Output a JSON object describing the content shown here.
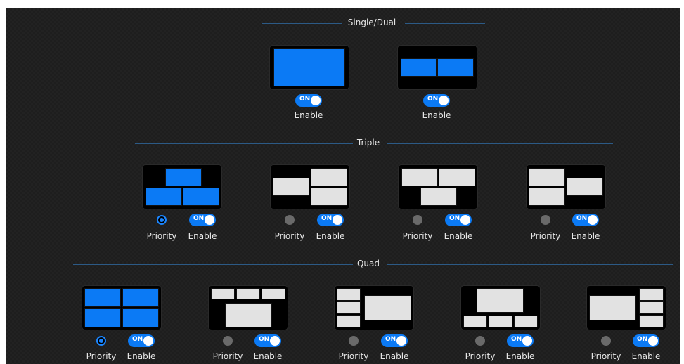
{
  "sections": {
    "single_dual": "Single/Dual",
    "triple": "Triple",
    "quad": "Quad"
  },
  "labels": {
    "priority": "Priority",
    "enable": "Enable",
    "toggle_on": "ON"
  },
  "colors": {
    "active_tile": "#0b7af5",
    "inactive_tile": "#e2e2e2",
    "toggle_on": "#0b7af5",
    "divider": "#2c5a86"
  },
  "layouts": {
    "single_dual": [
      {
        "name": "single",
        "active": true,
        "enabled": true
      },
      {
        "name": "dual-side-by-side",
        "active": true,
        "enabled": true
      }
    ],
    "triple": [
      {
        "name": "triple-one-top-two-bottom",
        "active": true,
        "priority": true,
        "enabled": true
      },
      {
        "name": "triple-left-small-right-two",
        "active": false,
        "priority": false,
        "enabled": true
      },
      {
        "name": "triple-two-top-one-bottom",
        "active": false,
        "priority": false,
        "enabled": true
      },
      {
        "name": "triple-two-left-right-one",
        "active": false,
        "priority": false,
        "enabled": true
      }
    ],
    "quad": [
      {
        "name": "quad-grid",
        "active": true,
        "priority": true,
        "enabled": true
      },
      {
        "name": "quad-three-top-one-bottom",
        "active": false,
        "priority": false,
        "enabled": true
      },
      {
        "name": "quad-three-left-one-right",
        "active": false,
        "priority": false,
        "enabled": true
      },
      {
        "name": "quad-one-top-three-bottom",
        "active": false,
        "priority": false,
        "enabled": true
      },
      {
        "name": "quad-one-left-three-right",
        "active": false,
        "priority": false,
        "enabled": true
      }
    ]
  }
}
